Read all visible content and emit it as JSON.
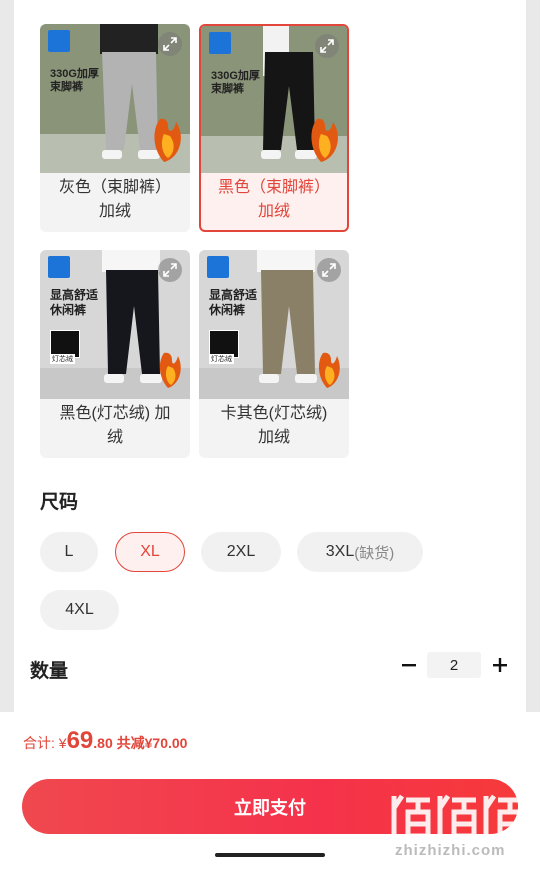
{
  "variants": [
    {
      "caption": "灰色（束脚裤）\n加绒",
      "promo": "330G加厚\n束脚裤",
      "selected": false
    },
    {
      "caption": "黑色（束脚裤）\n加绒",
      "promo": "330G加厚\n束脚裤",
      "selected": true
    },
    {
      "caption": "黑色(灯芯绒) 加\n绒",
      "promo": "显高舒适\n休闲裤",
      "fabric": "灯芯绒",
      "selected": false
    },
    {
      "caption": "卡其色(灯芯绒)\n加绒",
      "promo": "显高舒适\n休闲裤",
      "fabric": "灯芯绒",
      "selected": false
    }
  ],
  "size_section": {
    "title": "尺码",
    "options": [
      {
        "label": "L",
        "selected": false
      },
      {
        "label": "XL",
        "selected": true
      },
      {
        "label": "2XL",
        "selected": false
      },
      {
        "label": "3XL",
        "note": "(缺货)",
        "selected": false
      },
      {
        "label": "4XL",
        "selected": false
      }
    ]
  },
  "quantity": {
    "label": "数量",
    "value": "2"
  },
  "footer": {
    "total_label": "合计: ",
    "currency": "¥",
    "price_int": "69",
    "price_dec": ".80",
    "discount": " 共减¥70.00",
    "pay_button": "立即支付"
  },
  "watermark": {
    "text": "zhizhizhi.com"
  },
  "colors": {
    "accent": "#e2453a",
    "button": "#f5324b"
  }
}
